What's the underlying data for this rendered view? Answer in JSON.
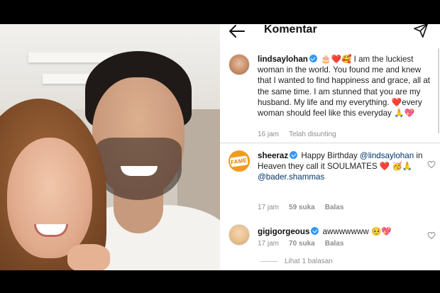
{
  "header": {
    "title": "Komentar",
    "back_icon": "arrow-left-icon",
    "share_icon": "paper-plane-icon"
  },
  "caption": {
    "username": "lindsaylohan",
    "verified": true,
    "text_emoji_prefix": "🎂❤️🥰",
    "text_part1": " I am the luckiest woman in the world. You found me and knew that I wanted to find happiness and grace, all at the same time. I am stunned that you are my husband. My life and my everything. ",
    "text_emoji_mid": "❤️",
    "text_part2": "every woman should feel like this everyday ",
    "text_emoji_end": "🙏💖",
    "time": "16 jam",
    "edited": "Telah disunting"
  },
  "comments": [
    {
      "username": "sheeraz",
      "avatar_text": "FAME",
      "verified": true,
      "text_part1": "Happy Birthday ",
      "mention1": "@lindsaylohan",
      "text_part2": " in Heaven they call it SOULMATES ",
      "emoji": "❤️ 🥳🙏",
      "mention2": "@bader.shammas",
      "time": "17 jam",
      "likes": "59 suka",
      "reply": "Balas"
    },
    {
      "username": "gigigorgeous",
      "verified": true,
      "text": "awwwwwww ",
      "emoji": "🥺💖",
      "time": "17 jam",
      "likes": "70 suka",
      "reply": "Balas",
      "view_replies": "Lihat 1 balasan"
    }
  ],
  "colors": {
    "verified": "#3897f0",
    "mention": "#00376b",
    "meta": "#8e8e8e",
    "heart_emoji": "#e0245e"
  }
}
